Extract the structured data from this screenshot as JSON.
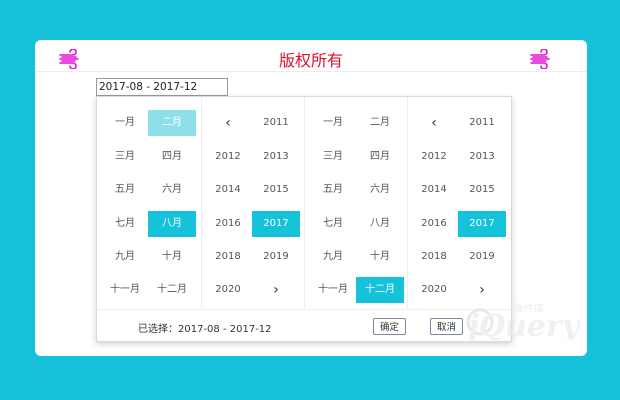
{
  "header": {
    "title": "版权所有",
    "icon_left": "wind-icon",
    "icon_right": "wind-icon",
    "icon_color": "#e010d0"
  },
  "range_input": {
    "value": "2017-08 - 2017-12"
  },
  "start_months": {
    "items": [
      "一月",
      "二月",
      "三月",
      "四月",
      "五月",
      "六月",
      "七月",
      "八月",
      "九月",
      "十月",
      "十一月",
      "十二月"
    ],
    "highlighted_light": "二月",
    "selected": "八月"
  },
  "start_years": {
    "prev_icon": "‹",
    "next_icon": "›",
    "items": [
      "2011",
      "2012",
      "2013",
      "2014",
      "2015",
      "2016",
      "2017",
      "2018",
      "2019",
      "2020"
    ],
    "selected": "2017"
  },
  "end_months": {
    "items": [
      "一月",
      "二月",
      "三月",
      "四月",
      "五月",
      "六月",
      "七月",
      "八月",
      "九月",
      "十月",
      "十一月",
      "十二月"
    ],
    "selected": "十二月"
  },
  "end_years": {
    "prev_icon": "‹",
    "next_icon": "›",
    "items": [
      "2011",
      "2012",
      "2013",
      "2014",
      "2015",
      "2016",
      "2017",
      "2018",
      "2019",
      "2020"
    ],
    "selected": "2017"
  },
  "footer": {
    "selected_text": "已选择：2017-08 - 2017-12",
    "confirm_label": "确定",
    "cancel_label": "取消"
  },
  "watermark": {
    "text": "jQuery插件库"
  },
  "colors": {
    "accent": "#16c2d9",
    "accent_light": "#8fdfea",
    "title_red": "#e0102a"
  }
}
